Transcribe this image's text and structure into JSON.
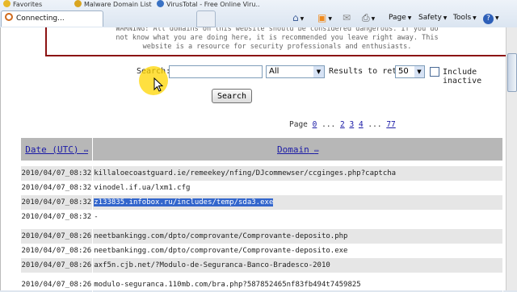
{
  "browser": {
    "tabs": [
      {
        "label": "Favorites"
      },
      {
        "label": "Malware Domain List"
      },
      {
        "label": "VirusTotal - Free Online Viru..."
      }
    ],
    "active_tab": "Connecting...",
    "toolbar": {
      "page": "Page",
      "safety": "Safety",
      "tools": "Tools"
    }
  },
  "warning": {
    "lines": [
      "WARNING: All domains on this website should be considered dangerous. If you do",
      "not know what you are doing here, it is recommended you leave right away. This",
      "website is a resource for security professionals and enthusiasts."
    ]
  },
  "search": {
    "label": "Search:",
    "value": "",
    "filter_selected": "All",
    "results_label": "Results to return:",
    "results_value": "50",
    "include_inactive_label": "Include inactive",
    "button_label": "Search"
  },
  "pager": {
    "prefix": "Page",
    "pages": [
      "0",
      "2",
      "3",
      "4",
      "77"
    ],
    "ellipsis": "..."
  },
  "table": {
    "headers": {
      "date": "Date (UTC)",
      "domain": "Domain"
    },
    "rows": [
      {
        "date": "2010/04/07_08:32",
        "domain": "killaloecoastguard.ie/remeekey/nfing/DJcommewser/ccginges.php?captcha"
      },
      {
        "date": "2010/04/07_08:32",
        "domain": "vinodel.if.ua/lxm1.cfg"
      },
      {
        "date": "2010/04/07_08:32",
        "domain": "z133835.infobox.ru/includes/temp/sda3.exe",
        "highlight": true
      },
      {
        "date": "2010/04/07_08:32",
        "domain": "-"
      },
      {
        "date": "2010/04/07_08:26",
        "domain": "neetbankingg.com/dpto/comprovante/Comprovante-deposito.php"
      },
      {
        "date": "2010/04/07_08:26",
        "domain": "neetbankingg.com/dpto/comprovante/Comprovante-deposito.exe"
      },
      {
        "date": "2010/04/07_08:26",
        "domain": "axf5n.cjb.net/?Modulo-de-Seguranca-Banco-Bradesco-2010"
      },
      {
        "date": "2010/04/07_08:26",
        "domain": "modulo-seguranca.110mb.com/bra.php?587852465nf83fb494t7459825"
      }
    ]
  }
}
